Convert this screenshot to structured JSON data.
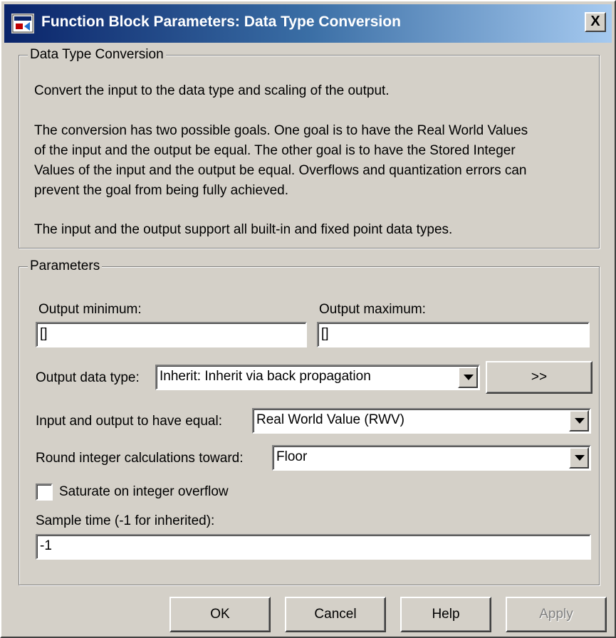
{
  "window": {
    "title": "Function Block Parameters: Data Type Conversion",
    "close_label": "X",
    "icon": "simulink-block-icon"
  },
  "description_group": {
    "label": "Data Type Conversion",
    "paragraph1": "Convert the input to the data type and scaling of the output.",
    "paragraph2_lines": [
      "The conversion has two possible goals. One goal is to have the Real World Values",
      "of the input and the output be equal.  The other goal is to have the Stored Integer",
      "Values of the input and the output be equal.  Overflows and quantization errors can",
      "prevent the goal from being fully achieved."
    ],
    "paragraph3": "The input and the output support all built-in and fixed point data types."
  },
  "parameters": {
    "label": "Parameters",
    "output_min": {
      "label": "Output minimum:",
      "value": "[]"
    },
    "output_max": {
      "label": "Output maximum:",
      "value": "[]"
    },
    "output_data_type": {
      "label": "Output data type:",
      "value": "Inherit: Inherit via back propagation",
      "assistant_button": ">>"
    },
    "equal": {
      "label": "Input and output to have equal:",
      "value": "Real World Value (RWV)"
    },
    "round": {
      "label": "Round integer calculations toward:",
      "value": "Floor"
    },
    "saturate": {
      "label": "Saturate on integer overflow",
      "checked": false
    },
    "sample_time": {
      "label": "Sample time (-1 for inherited):",
      "value": "-1"
    }
  },
  "buttons": {
    "ok": "OK",
    "cancel": "Cancel",
    "help": "Help",
    "apply": "Apply"
  },
  "colors": {
    "dialog_bg": "#d4d0c8",
    "titlebar_start": "#0a246a",
    "titlebar_end": "#a6caf0"
  }
}
